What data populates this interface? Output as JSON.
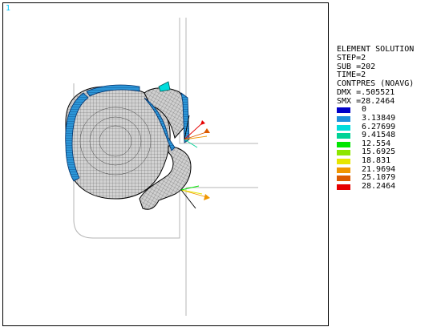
{
  "window_number": "1",
  "legend": {
    "header": [
      "ELEMENT SOLUTION",
      "STEP=2",
      "SUB =202",
      "TIME=2",
      "CONTPRES (NOAVG)",
      "DMX =.505521",
      "SMX =28.2464"
    ],
    "entries": [
      {
        "value": "0",
        "color": "#0000c8"
      },
      {
        "value": "3.13849",
        "color": "#1e90dc"
      },
      {
        "value": "6.27699",
        "color": "#00dcdc"
      },
      {
        "value": "9.41548",
        "color": "#00d296"
      },
      {
        "value": "12.554",
        "color": "#00e600"
      },
      {
        "value": "15.6925",
        "color": "#8ce600"
      },
      {
        "value": "18.831",
        "color": "#e6e600"
      },
      {
        "value": "21.9694",
        "color": "#f09600"
      },
      {
        "value": "25.1079",
        "color": "#dc5a00"
      },
      {
        "value": "28.2464",
        "color": "#e60000"
      }
    ]
  }
}
